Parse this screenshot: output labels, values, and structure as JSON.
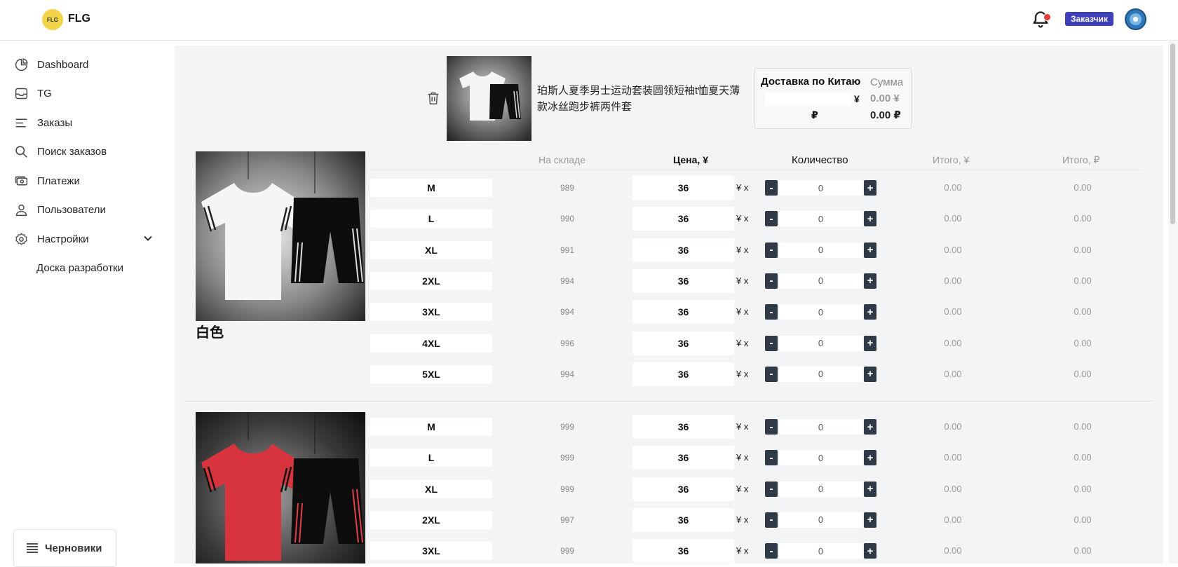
{
  "header": {
    "logo_mark": "FLG",
    "logo_text": "FLG",
    "role_badge": "Заказчик",
    "colors": {
      "badge": "#3f3fb8",
      "notification_dot": "#e53935"
    }
  },
  "sidebar": {
    "items": [
      {
        "label": "Dashboard",
        "icon": "pie-chart-icon"
      },
      {
        "label": "TG",
        "icon": "inbox-icon"
      },
      {
        "label": "Заказы",
        "icon": "list-icon"
      },
      {
        "label": "Поиск заказов",
        "icon": "search-icon"
      },
      {
        "label": "Платежи",
        "icon": "cash-icon"
      },
      {
        "label": "Пользователи",
        "icon": "user-icon"
      },
      {
        "label": "Настройки",
        "icon": "gear-icon"
      },
      {
        "label": "Доска разработки",
        "icon": ""
      }
    ],
    "drafts_label": "Черновики"
  },
  "product": {
    "title": "珀斯人夏季男士运动套装圆领短袖t恤夏天薄款冰丝跑步裤两件套",
    "shipping": {
      "title": "Доставка по Китаю",
      "sum_label": "Сумма",
      "yen_symbol": "¥",
      "rub_symbol": "₽",
      "sum_yen": "0.00 ¥",
      "sum_rub": "0.00 ₽"
    },
    "table_headers": {
      "stock": "На складе",
      "price": "Цена, ¥",
      "qty": "Количество",
      "total_yen": "Итого, ¥",
      "total_rub": "Итого, ₽"
    },
    "row_suffix": "¥ x",
    "minus": "-",
    "plus": "+",
    "variants": [
      {
        "name": "白色",
        "rows": [
          {
            "size": "M",
            "stock": "989",
            "price": "36",
            "qty": "0",
            "total_yen": "0.00",
            "total_rub": "0.00"
          },
          {
            "size": "L",
            "stock": "990",
            "price": "36",
            "qty": "0",
            "total_yen": "0.00",
            "total_rub": "0.00"
          },
          {
            "size": "XL",
            "stock": "991",
            "price": "36",
            "qty": "0",
            "total_yen": "0.00",
            "total_rub": "0.00"
          },
          {
            "size": "2XL",
            "stock": "994",
            "price": "36",
            "qty": "0",
            "total_yen": "0.00",
            "total_rub": "0.00"
          },
          {
            "size": "3XL",
            "stock": "994",
            "price": "36",
            "qty": "0",
            "total_yen": "0.00",
            "total_rub": "0.00"
          },
          {
            "size": "4XL",
            "stock": "996",
            "price": "36",
            "qty": "0",
            "total_yen": "0.00",
            "total_rub": "0.00"
          },
          {
            "size": "5XL",
            "stock": "994",
            "price": "36",
            "qty": "0",
            "total_yen": "0.00",
            "total_rub": "0.00"
          }
        ]
      },
      {
        "name": "",
        "rows": [
          {
            "size": "M",
            "stock": "999",
            "price": "36",
            "qty": "0",
            "total_yen": "0.00",
            "total_rub": "0.00"
          },
          {
            "size": "L",
            "stock": "999",
            "price": "36",
            "qty": "0",
            "total_yen": "0.00",
            "total_rub": "0.00"
          },
          {
            "size": "XL",
            "stock": "999",
            "price": "36",
            "qty": "0",
            "total_yen": "0.00",
            "total_rub": "0.00"
          },
          {
            "size": "2XL",
            "stock": "997",
            "price": "36",
            "qty": "0",
            "total_yen": "0.00",
            "total_rub": "0.00"
          },
          {
            "size": "3XL",
            "stock": "999",
            "price": "36",
            "qty": "0",
            "total_yen": "0.00",
            "total_rub": "0.00"
          }
        ]
      }
    ]
  }
}
